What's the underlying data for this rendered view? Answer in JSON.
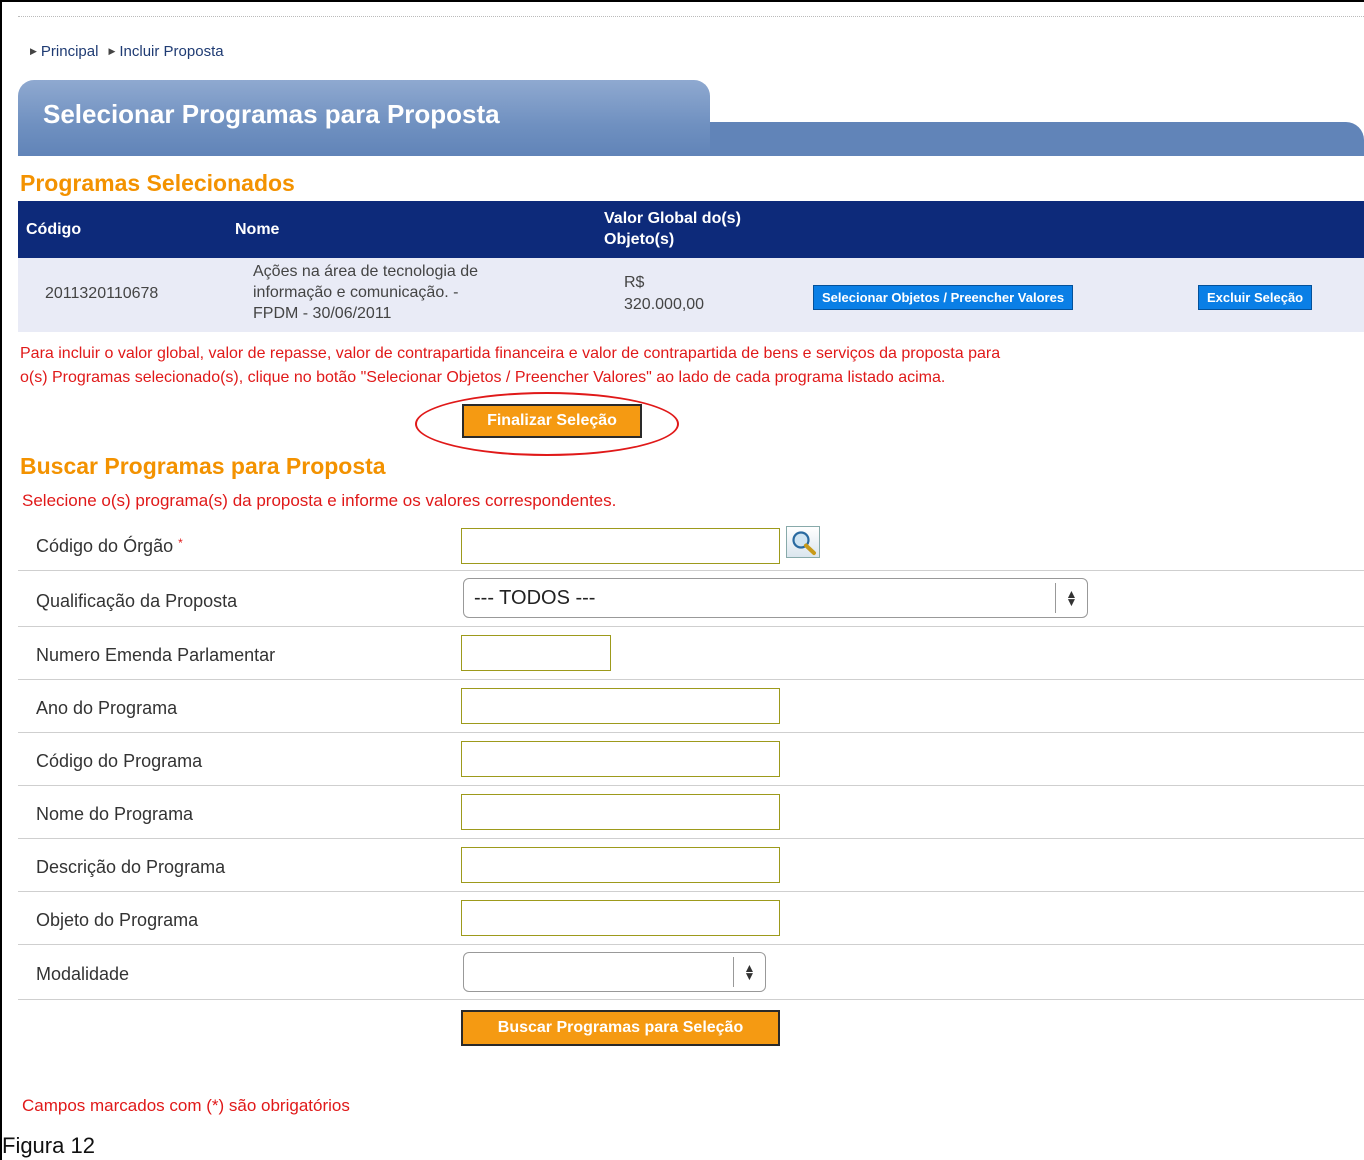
{
  "breadcrumb": [
    "Principal",
    "Incluir Proposta"
  ],
  "page_title": "Selecionar Programas para Proposta",
  "selected": {
    "title": "Programas Selecionados",
    "headers": {
      "codigo": "Código",
      "nome": "Nome",
      "valor_1": "Valor Global do(s)",
      "valor_2": "Objeto(s)"
    },
    "row": {
      "codigo": "2011320110678",
      "nome_1": "Ações na área de tecnologia de",
      "nome_2": "informação e comunicação. -",
      "nome_3": "FPDM - 30/06/2011",
      "valor_1": "R$",
      "valor_2": "320.000,00",
      "btn_select": "Selecionar Objetos / Preencher Valores",
      "btn_delete": "Excluir Seleção"
    }
  },
  "info_line_1": "Para incluir o valor global, valor de repasse, valor de contrapartida financeira e valor de contrapartida de bens e serviços da proposta para",
  "info_line_2": "o(s) Programas selecionado(s), clique no botão \"Selecionar Objetos / Preencher Valores\" ao lado de cada programa listado acima.",
  "finalize_button": "Finalizar Seleção",
  "search": {
    "title": "Buscar Programas para Proposta",
    "subtitle": "Selecione o(s) programa(s) da proposta e informe os valores correspondentes.",
    "labels": {
      "orgao": "Código do Órgão",
      "required_mark": "*",
      "qualificacao": "Qualificação da Proposta",
      "emenda": "Numero Emenda Parlamentar",
      "ano": "Ano do Programa",
      "codigo": "Código do Programa",
      "nome": "Nome do Programa",
      "descricao": "Descrição do Programa",
      "objeto": "Objeto do Programa",
      "modalidade": "Modalidade"
    },
    "qualificacao_value": "--- TODOS ---",
    "modalidade_value": "",
    "search_button": "Buscar Programas para Seleção"
  },
  "footer_note": "Campos marcados com (*) são obrigatórios",
  "caption": "Figura 12"
}
